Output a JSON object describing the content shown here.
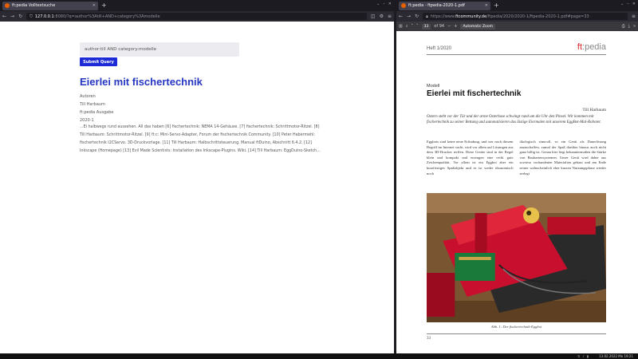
{
  "left": {
    "tab_title": "ft:pedia Volltextsuche",
    "url_host": "127.0.0.1",
    "url_path": ":8080/?q=author%3Atill+AND+category%3Amodelle",
    "search_value": "author:till AND category:modelle",
    "submit_label": "Submit Query",
    "result_title": "Eierlei mit fischertechnik",
    "meta": [
      "Autoren",
      "Till Harbaum",
      "ft:pedia Ausgabe",
      "2020-1"
    ],
    "snippet": [
      "...Ei halbwegs rund aussehen. All das haben [6] fischertechnik: NEMA 14-Gehäuse. [7] fischertechnik: Schrittmotor-Ritzel. [8]",
      "Till Harbaum: Schrittmotor-Ritzel. [9] ft:c: Mini-Servo-Adapter, Forum der fischertechnik Community. [10] Peter Habermehl:",
      "fischertechnik I2CServo. 3D-Druckvorlage. [11] Till Harbaum: Halbschrittsteuerung. Manual ftDuino, Abschnitt 6.4.2. [12]",
      "Inkscape (Homepage) [13] Evil Made Scientists: Installation des Inkscape-Plugins. Wiki. [14] Till Harbaum: EggDuino-Sketch..."
    ]
  },
  "right": {
    "tab_title": "ft:pedia - ftpedia-2020-1.pdf",
    "url_host": "ftcommunity.de",
    "url_prefix": "https://www.",
    "url_path": "/ftpedia/2020/2020-1/ftpedia-2020-1.pdf#page=33",
    "page_current": "33",
    "page_total": "of 94",
    "zoom": "Automatic Zoom",
    "pdf": {
      "issue": "Heft 1/2020",
      "logo_a": "ft",
      "logo_b": ":pedia",
      "category": "Modell",
      "title": "Eierlei mit fischertechnik",
      "author": "Till Harbaum",
      "abstract": "Ostern steht vor der Tür und der arme Osterhase schwingt rund um die Uhr den Pinsel. Wir kommen mit fischertechnik zu seiner Rettung und automatisieren das lästige Eiermalen mit unserem EggBot-Mal-Roboter.",
      "col1": "Eggbots sind keine neue Erfindung, und wer nach diesem Begriff im Internet sucht, wird vor allem auf Lösungen aus dem 3D-Drucker treffen. Diese Geräte sind in der Regel klein und kompakt und erzeugen eine recht gute Zeichenqualität. Vor allem ist ein Eggbot aber ein kurzfristiges Spaßobjekt und es ist weder ökonomisch noch",
      "col2": "ökologisch sinnvoll, so ein Gerät als Dauerlösung anzuschaffen, zumal der Spaß darüber hinaus auch nicht ganz billig ist. Genau hier liegt bekanntermaßen die Stärke von Baukastensystemen. Unser Gerät wird daher aus sowieso vorhandenen Materialien gebaut und am Ende seiner wahrscheinlich eher kurzen Nutzungsphase wieder zerlegt",
      "caption": "Abb. 1: Der fischertechnik-Eggbot",
      "page_number": "33"
    }
  },
  "taskbar": {
    "clock": "13.02.2022 Mo 19:21"
  }
}
